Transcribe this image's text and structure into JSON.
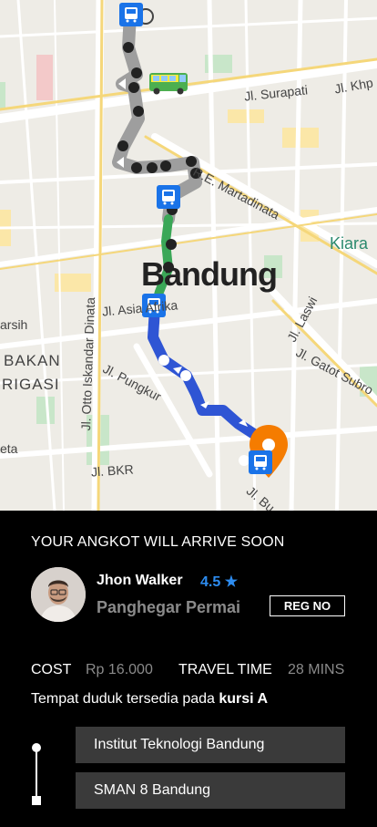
{
  "map": {
    "city_label": "Bandung",
    "area_labels": {
      "kiara": "Kiara",
      "bakan": "BAKAN",
      "rigasi": "RIGASI",
      "arsih": "arsih",
      "eta": "eta"
    },
    "streets": {
      "surapati": "Jl. Surapati",
      "khp": "Jl. Khp",
      "martadinata": "R.E. Martadinata",
      "asia_afrika": "Jl. Asia Afrika",
      "otto": "Jl. Otto Iskandar Dinata",
      "laswi": "Jl. Laswi",
      "gatot": "Jl. Gatot Subro",
      "pungkur": "Jl. Pungkur",
      "bkr": "Jl. BKR",
      "bu": "Jl. Bu"
    },
    "colors": {
      "route_gray": "#9e9e9e",
      "route_green": "#3aa757",
      "route_blue": "#2f55d4",
      "bus_stop": "#1a73e8",
      "destination": "#f57c00"
    },
    "icons": [
      "bus-stop-icon",
      "angkot-vehicle-icon",
      "destination-pin-icon",
      "direction-arrow-icon"
    ]
  },
  "panel": {
    "arrival_text": "YOUR ANGKOT WILL ARRIVE SOON",
    "driver_name": "Jhon Walker",
    "rating": "4.5 ★",
    "route_name": "Panghegar Permai",
    "reg_button": "REG NO",
    "cost_label": "COST",
    "cost_value": "Rp 16.000",
    "time_label": "TRAVEL TIME",
    "time_value": "28 MINS",
    "seat_text_prefix": "Tempat duduk tersedia pada ",
    "seat_text_bold": "kursi A",
    "origin": "Institut Teknologi Bandung",
    "destination": "SMAN 8 Bandung"
  }
}
